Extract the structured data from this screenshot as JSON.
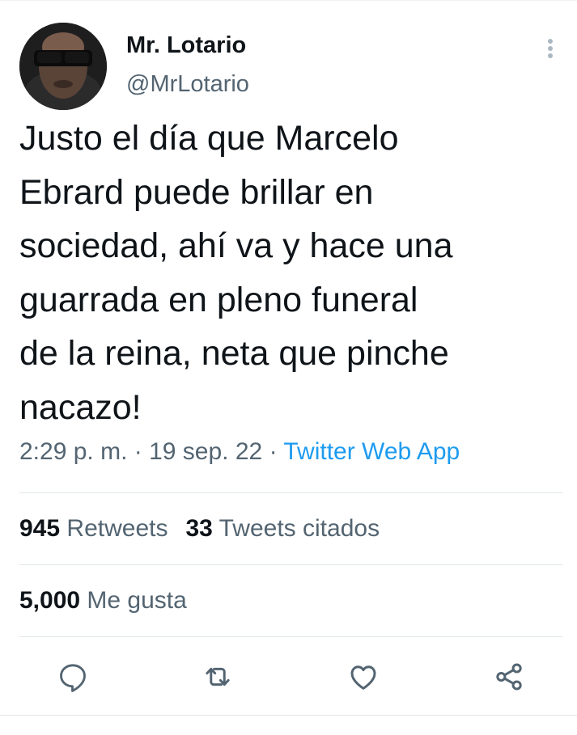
{
  "author": {
    "display_name": "Mr. Lotario",
    "handle": "@MrLotario"
  },
  "tweet": {
    "lines": [
      "Justo el día que Marcelo",
      "Ebrard puede brillar en",
      "sociedad, ahí va y hace una",
      "guarrada en pleno funeral",
      "de la reina, neta que pinche",
      "nacazo!"
    ],
    "time": "2:29 p. m.",
    "date": "19 sep. 22",
    "separator": "·",
    "source": "Twitter Web App"
  },
  "stats": {
    "retweets_count": "945",
    "retweets_label": "Retweets",
    "quotes_count": "33",
    "quotes_label": "Tweets citados",
    "likes_count": "5,000",
    "likes_label": "Me gusta"
  },
  "icons": {
    "more": "more-vertical-icon",
    "reply": "reply-icon",
    "retweet": "retweet-icon",
    "like": "heart-icon",
    "share": "share-icon"
  },
  "colors": {
    "text": "#0f1419",
    "secondary": "#536471",
    "link": "#1d9bf0",
    "divider": "#e1e6e9"
  }
}
